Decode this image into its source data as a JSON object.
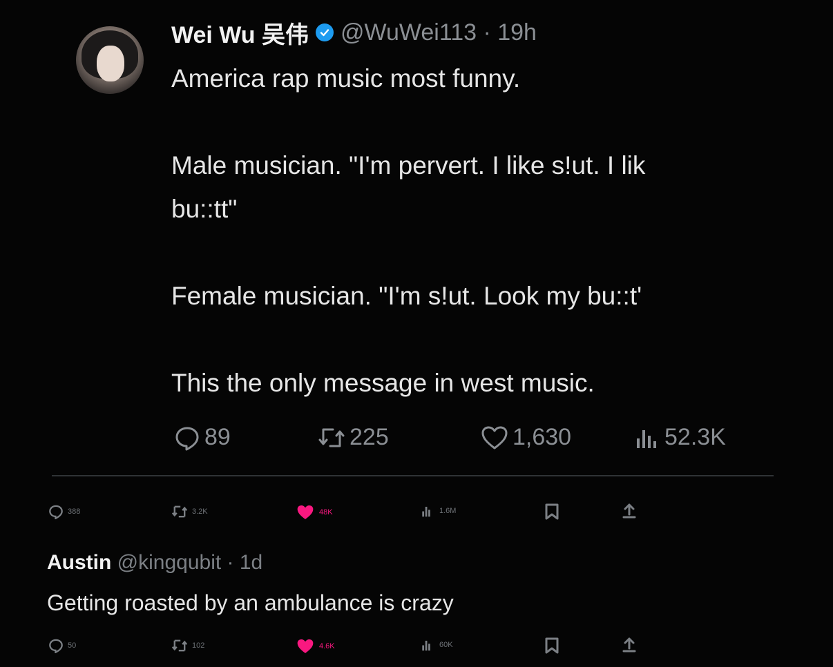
{
  "quoted_tweet": {
    "display_name": "Wei Wu 吴伟",
    "verified_icon": "verified-badge-icon",
    "handle_time": "@WuWei113 · 19h",
    "lines": [
      "America rap music most funny.",
      "",
      "Male musician. \"I'm pervert. I like s!ut. I lik",
      "bu::tt\"",
      "",
      "Female musician. \"I'm s!ut. Look my bu::t'",
      "",
      "This the only message in west music."
    ],
    "stats": {
      "replies": "89",
      "retweets": "225",
      "likes": "1,630",
      "views": "52.3K"
    }
  },
  "main_tweet_actions": {
    "replies": "388",
    "retweets": "3.2K",
    "likes": "48K",
    "views": "1.6M"
  },
  "reply": {
    "display_name": "Austin",
    "handle_time": "@kingqubit · 1d",
    "text": "Getting roasted by an ambulance is crazy",
    "actions": {
      "replies": "50",
      "retweets": "102",
      "likes": "4.6K",
      "views": "60K"
    }
  },
  "colors": {
    "background": "#050505",
    "text": "#e6e6e6",
    "muted": "#8b8f94",
    "verified": "#1d9bf0",
    "like": "#f91880"
  }
}
